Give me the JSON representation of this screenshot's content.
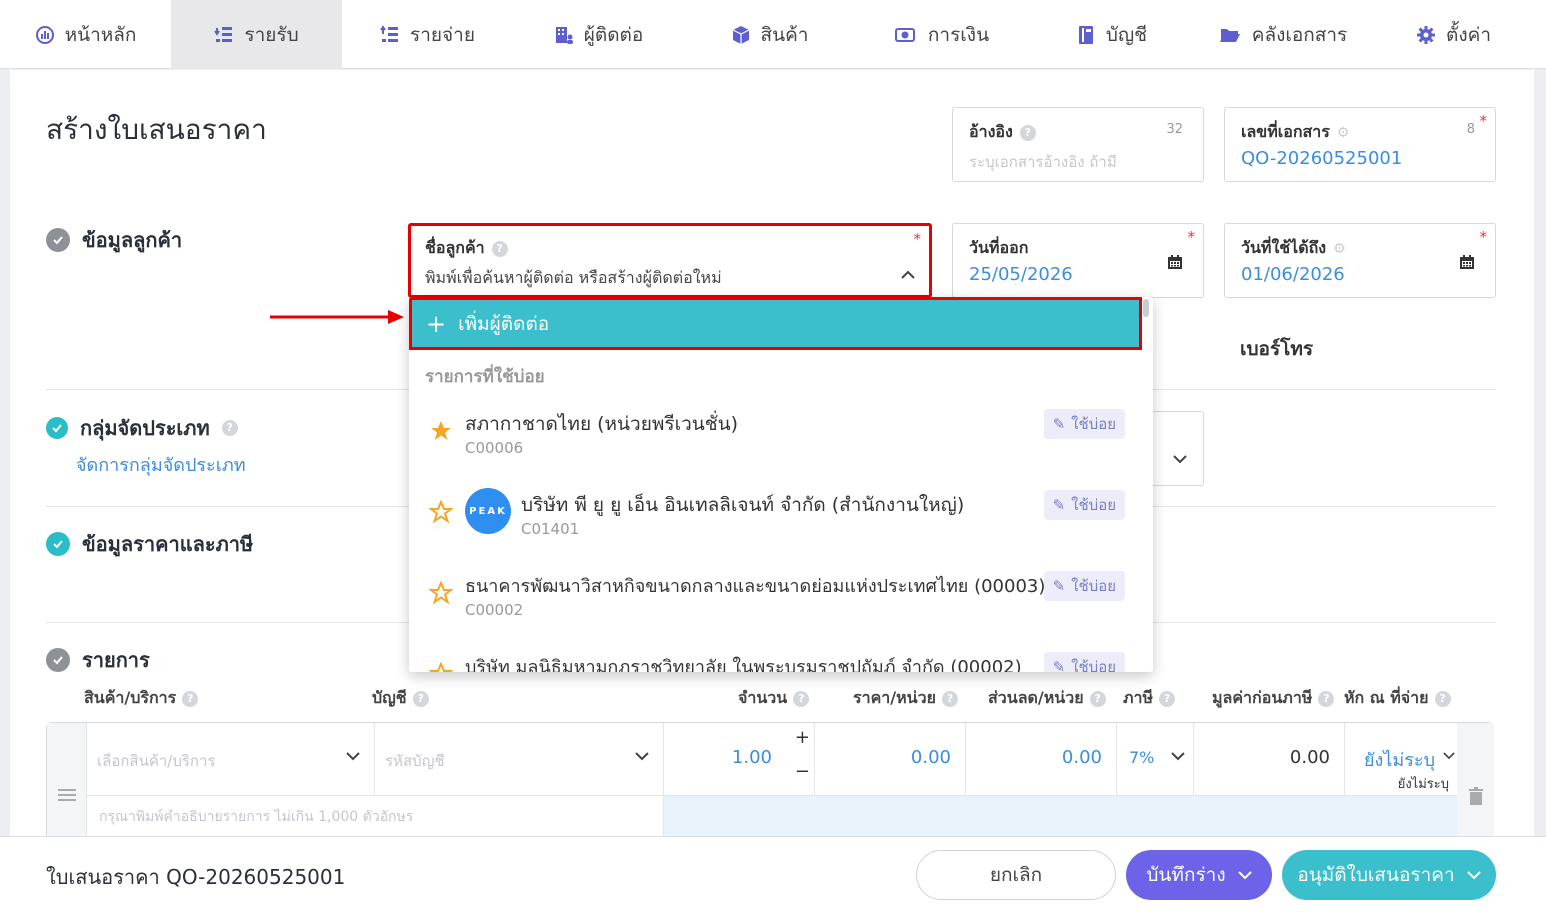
{
  "nav": [
    {
      "label": "หน้าหลัก",
      "icon": "dashboard-icon"
    },
    {
      "label": "รายรับ",
      "icon": "income-icon"
    },
    {
      "label": "รายจ่าย",
      "icon": "expense-icon"
    },
    {
      "label": "ผู้ติดต่อ",
      "icon": "contacts-icon"
    },
    {
      "label": "สินค้า",
      "icon": "product-box-icon"
    },
    {
      "label": "การเงิน",
      "icon": "money-icon"
    },
    {
      "label": "บัญชี",
      "icon": "ledger-icon"
    },
    {
      "label": "คลังเอกสาร",
      "icon": "folder-icon"
    },
    {
      "label": "ตั้งค่า",
      "icon": "gear-icon"
    }
  ],
  "page_title": "สร้างใบเสนอราคา",
  "reference": {
    "label": "อ้างอิง",
    "counter": "32",
    "placeholder": "ระบุเอกสารอ้างอิง ถ้ามี"
  },
  "doc_number": {
    "label": "เลขที่เอกสาร",
    "counter": "8",
    "value": "QO-20260525001",
    "required": "*"
  },
  "customer": {
    "label": "ชื่อลูกค้า",
    "placeholder": "พิมพ์เพื่อค้นหาผู้ติดต่อ หรือสร้างผู้ติดต่อใหม่",
    "required": "*"
  },
  "issue_date": {
    "label": "วันที่ออก",
    "value": "25/05/2026",
    "required": "*"
  },
  "valid_until": {
    "label": "วันที่ใช้ได้ถึง",
    "value": "01/06/2026",
    "required": "*"
  },
  "phone_label": "เบอร์โทร",
  "sections": {
    "customer_info": "ข้อมูลลูกค้า",
    "category": "กลุ่มจัดประเภท",
    "category_link": "จัดการกลุ่มจัดประเภท",
    "price_tax": "ข้อมูลราคาและภาษี",
    "items": "รายการ"
  },
  "columns": [
    "สินค้า/บริการ",
    "บัญชี",
    "จำนวน",
    "ราคา/หน่วย",
    "ส่วนลด/หน่วย",
    "ภาษี",
    "มูลค่าก่อนภาษี",
    "หัก ณ ที่จ่าย"
  ],
  "line_item": {
    "product_placeholder": "เลือกสินค้า/บริการ",
    "account_placeholder": "รหัสบัญชี",
    "qty": "1.00",
    "price": "0.00",
    "discount": "0.00",
    "tax": "7%",
    "pretax": "0.00",
    "wht": "ยังไม่ระบุ",
    "wht_sub": "ยังไม่ระบุ",
    "desc_placeholder": "กรุณาพิมพ์คำอธิบายรายการ ไม่เกิน 1,000 ตัวอักษร"
  },
  "dropdown": {
    "add_label": "เพิ่มผู้ติดต่อ",
    "frequent_header": "รายการที่ใช้บ่อย",
    "badge": "ใช้บ่อย",
    "items": [
      {
        "name": "สภากาชาดไทย (หน่วยพรีเวนชั่น)",
        "code": "C00006"
      },
      {
        "name": "บริษัท พี ยู ยู เอ็น อินเทลลิเจนท์ จำกัด (สำนักงานใหญ่)",
        "code": "C01401",
        "logo": "PEAK"
      },
      {
        "name": "ธนาคารพัฒนาวิสาหกิจขนาดกลางและขนาดย่อมแห่งประเทศไทย (00003)",
        "code": "C00002"
      },
      {
        "name": "บริษัท มูลนิธิมหามกุฏราชวิทยาลัย ในพระบรมราชูปถัมภ์ จำกัด (00002)",
        "code": ""
      }
    ]
  },
  "footer": {
    "doc_title": "ใบเสนอราคา QO-20260525001",
    "cancel": "ยกเลิก",
    "save_draft": "บันทึกร่าง",
    "approve": "อนุมัติใบเสนอราคา"
  },
  "colors": {
    "teal": "#3bbfcc",
    "purple": "#6c63e8",
    "highlight": "#e60000",
    "link": "#3c8dde"
  }
}
